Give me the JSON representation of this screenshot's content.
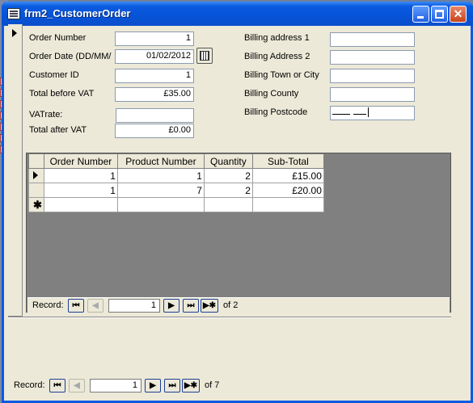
{
  "window": {
    "title": "frm2_CustomerOrder"
  },
  "form": {
    "left_fields": [
      {
        "label": "Order Number",
        "value": "1"
      },
      {
        "label": "Order Date (DD/MM/",
        "value": "01/02/2012"
      },
      {
        "label": "Customer ID",
        "value": "1"
      },
      {
        "label": "Total before VAT",
        "value": "£35.00"
      },
      {
        "label": "VATrate:",
        "value": ""
      },
      {
        "label": "Total after VAT",
        "value": "£0.00"
      }
    ],
    "right_fields": [
      {
        "label": "Billing address 1",
        "value": ""
      },
      {
        "label": "Billing Address 2",
        "value": ""
      },
      {
        "label": "Billing Town or City",
        "value": ""
      },
      {
        "label": "Billing County",
        "value": ""
      },
      {
        "label": "Billing Postcode",
        "value": ""
      }
    ]
  },
  "subform": {
    "columns": [
      "Order Number",
      "Product Number",
      "Quantity",
      "Sub-Total"
    ],
    "rows": [
      [
        "1",
        "1",
        "2",
        "£15.00"
      ],
      [
        "1",
        "7",
        "2",
        "£20.00"
      ]
    ],
    "new_row_marker": "✱",
    "nav": {
      "label": "Record:",
      "current": "1",
      "of_text": "of 2"
    }
  },
  "main_nav": {
    "label": "Record:",
    "current": "1",
    "of_text": "of 7"
  },
  "nav_icons": {
    "first": "⏮",
    "prev": "◀",
    "next": "▶",
    "last": "⏭",
    "new": "▶✱"
  }
}
